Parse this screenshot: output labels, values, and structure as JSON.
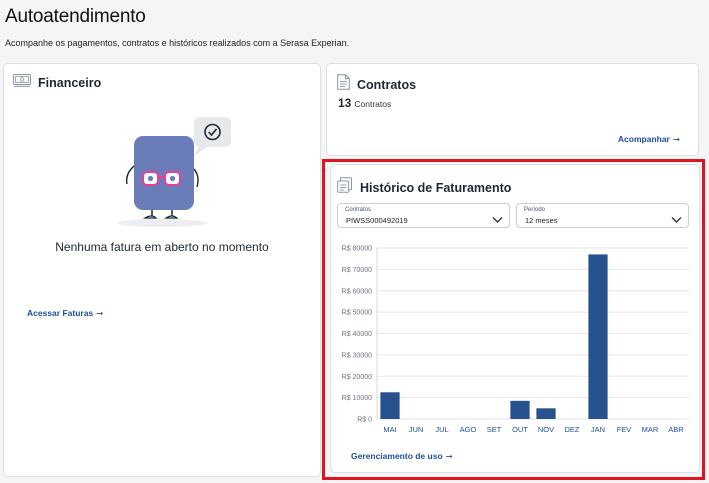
{
  "page": {
    "title": "Autoatendimento",
    "subtitle": "Acompanhe os pagamentos, contratos e históricos realizados com a Serasa Experian."
  },
  "financeiro": {
    "title": "Financeiro",
    "empty_message": "Nenhuma fatura em aberto no momento",
    "link": "Acessar Faturas",
    "link_arrow": "➞"
  },
  "contratos": {
    "title": "Contratos",
    "count": "13",
    "count_label": "Contratos",
    "link": "Acompanhar",
    "link_arrow": "➞"
  },
  "historico": {
    "title": "Histórico de Faturamento",
    "select_contratos": {
      "label": "Contratos",
      "value": "PIWSS000492019"
    },
    "select_periodo": {
      "label": "Período",
      "value": "12 meses"
    },
    "link": "Gerenciamento de uso",
    "link_arrow": "➞"
  },
  "colors": {
    "bar": "#28528f",
    "link": "#1e4f96",
    "highlight": "#e0141e",
    "mascot_body": "#6b7db8",
    "mascot_glasses": "#e8409a"
  },
  "chart_data": {
    "type": "bar",
    "categories": [
      "MAI",
      "JUN",
      "JUL",
      "AGO",
      "SET",
      "OUT",
      "NOV",
      "DEZ",
      "JAN",
      "FEV",
      "MAR",
      "ABR"
    ],
    "values": [
      12500,
      0,
      0,
      0,
      0,
      8500,
      5000,
      0,
      77000,
      0,
      0,
      0
    ],
    "ylim": [
      0,
      80000
    ],
    "y_ticks": [
      0,
      10000,
      20000,
      30000,
      40000,
      50000,
      60000,
      70000,
      80000
    ],
    "y_tick_labels": [
      "R$ 0",
      "R$ 10000",
      "R$ 20000",
      "R$ 30000",
      "R$ 40000",
      "R$ 50000",
      "R$ 60000",
      "R$ 70000",
      "R$ 80000"
    ],
    "grid": true,
    "xlabel": "",
    "ylabel": ""
  }
}
